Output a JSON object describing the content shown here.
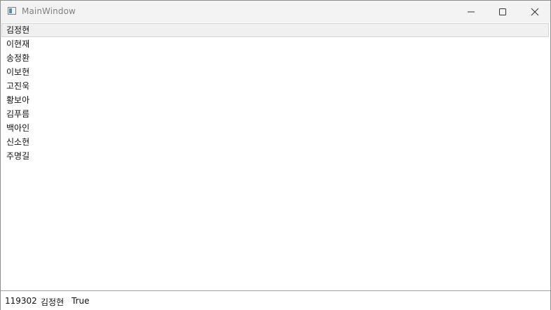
{
  "window": {
    "title": "MainWindow",
    "icon": "app-window-icon"
  },
  "caption_buttons": {
    "minimize_icon": "minimize-icon",
    "maximize_icon": "maximize-icon",
    "close_icon": "close-icon"
  },
  "list": {
    "items": [
      "김정현",
      "이현재",
      "송정환",
      "이보현",
      "고진욱",
      "황보아",
      "김푸름",
      "백아인",
      "신소현",
      "주명길"
    ],
    "selected_index": 0
  },
  "status": {
    "id": "119302",
    "name": "김정현",
    "flag": "True"
  }
}
